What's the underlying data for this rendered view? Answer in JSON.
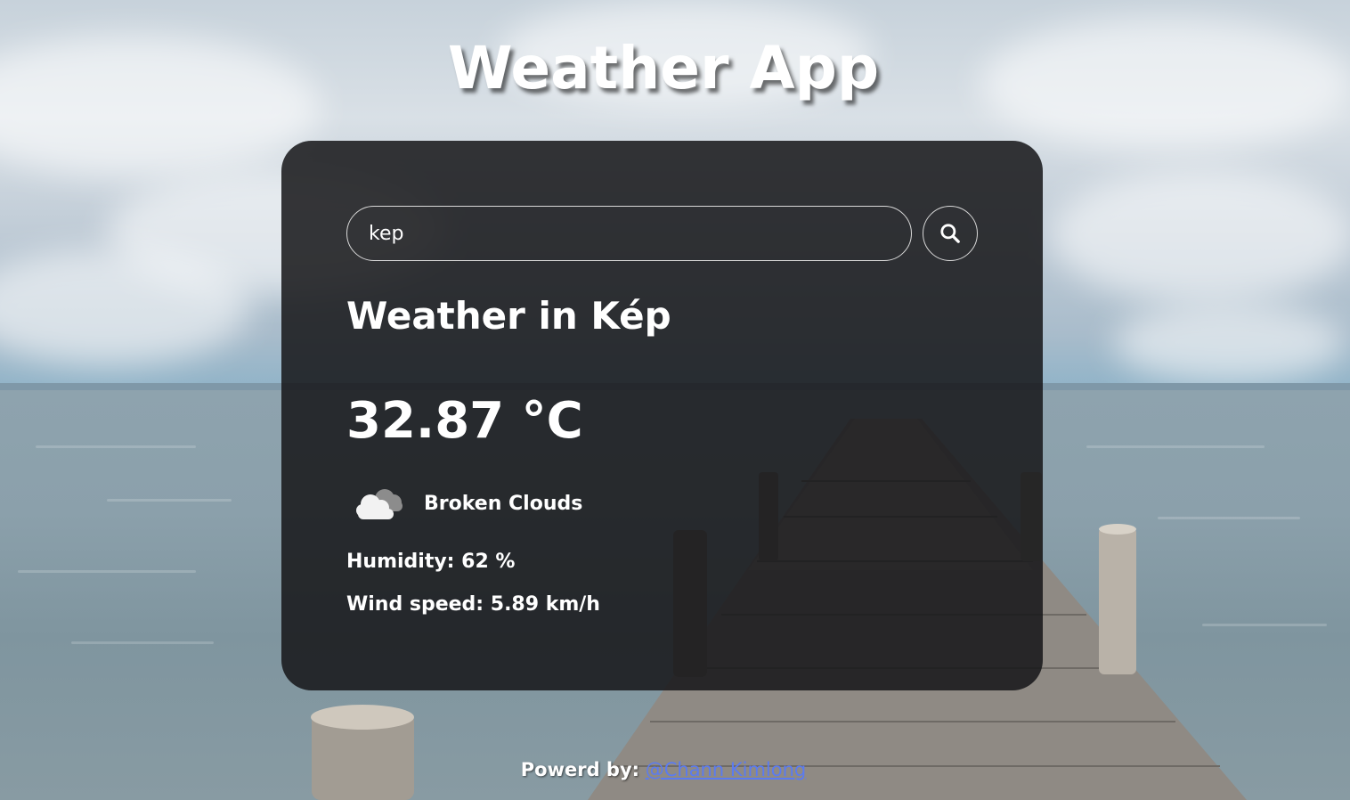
{
  "header": {
    "title": "Weather App"
  },
  "search": {
    "value": "kep",
    "placeholder": "",
    "button_icon": "search-icon"
  },
  "weather": {
    "city_line": "Weather in Kép",
    "temperature": "32.87 °C",
    "icon": "broken-clouds-icon",
    "description": "Broken Clouds",
    "humidity": "Humidity: 62 %",
    "wind": "Wind speed: 5.89 km/h"
  },
  "footer": {
    "label": "Powerd by:",
    "link_text": "@Chann Kimlong"
  },
  "colors": {
    "card_background": "#161618",
    "text": "#ffffff",
    "link": "#5b7bf0",
    "border": "#d9d9d9"
  }
}
